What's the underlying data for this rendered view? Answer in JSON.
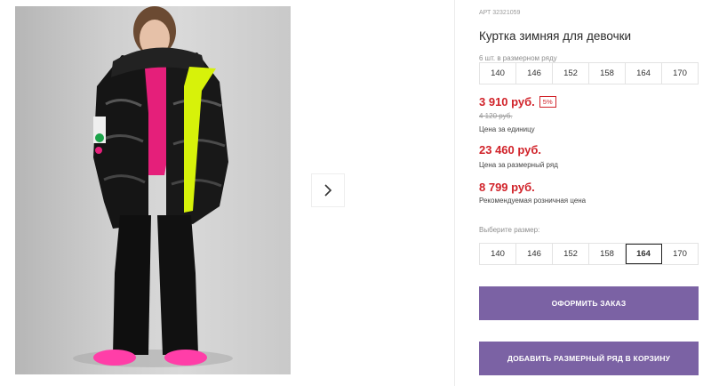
{
  "product": {
    "sku": "АРТ 32321059",
    "title": "Куртка зимняя для девочки"
  },
  "size_row_caption": "6 шт. в размерном ряду",
  "size_row": [
    "140",
    "146",
    "152",
    "158",
    "164",
    "170"
  ],
  "prices": {
    "unit_price": "3 910 руб.",
    "discount": "5%",
    "old_price": "4 120 руб.",
    "unit_label": "Цена за единицу",
    "row_price": "23 460 руб.",
    "row_label": "Цена за размерный ряд",
    "retail_price": "8 799 руб.",
    "retail_label": "Рекомендуемая розничная цена"
  },
  "size_select": {
    "caption": "Выберите размер:",
    "options": [
      "140",
      "146",
      "152",
      "158",
      "164",
      "170"
    ],
    "selected": "164"
  },
  "buttons": {
    "order": "ОФОРМИТЬ ЗАКАЗ",
    "add_row": "ДОБАВИТЬ РАЗМЕРНЫЙ РЯД В КОРЗИНУ"
  },
  "colors": {
    "accent": "#7b62a4",
    "price_red": "#d1232a"
  },
  "icons": {
    "next": "chevron-right-icon"
  }
}
